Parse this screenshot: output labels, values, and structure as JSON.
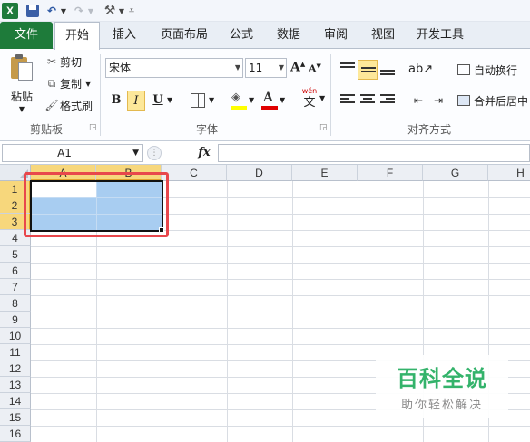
{
  "quick_access": {
    "app_icon": "X",
    "icons": [
      "excel-logo-icon",
      "save-icon",
      "undo-icon",
      "redo-icon",
      "customize-tools-icon"
    ]
  },
  "tabs": [
    {
      "id": "file",
      "label": "文件"
    },
    {
      "id": "home",
      "label": "开始"
    },
    {
      "id": "insert",
      "label": "插入"
    },
    {
      "id": "layout",
      "label": "页面布局"
    },
    {
      "id": "formulas",
      "label": "公式"
    },
    {
      "id": "data",
      "label": "数据"
    },
    {
      "id": "review",
      "label": "审阅"
    },
    {
      "id": "view",
      "label": "视图"
    },
    {
      "id": "developer",
      "label": "开发工具"
    }
  ],
  "active_tab": "home",
  "ribbon": {
    "clipboard": {
      "paste": "粘贴",
      "cut": "剪切",
      "copy": "复制",
      "format_painter": "格式刷",
      "group_label": "剪贴板"
    },
    "font": {
      "name": "宋体",
      "size": "11",
      "grow": "A",
      "shrink": "A",
      "bold": "B",
      "italic": "I",
      "underline": "U",
      "font_color_glyph": "A",
      "phonetic_top": "wén",
      "phonetic_main": "文",
      "highlight_color": "#ffff00",
      "font_color": "#e00000",
      "group_label": "字体"
    },
    "alignment": {
      "wrap_text": "自动换行",
      "merge_center": "合并后居中",
      "group_label": "对齐方式"
    }
  },
  "formula_bar": {
    "name_box": "A1",
    "fx": "fx",
    "formula": ""
  },
  "grid": {
    "columns": [
      "A",
      "B",
      "C",
      "D",
      "E",
      "F",
      "G",
      "H"
    ],
    "rows": [
      "1",
      "2",
      "3",
      "4",
      "5",
      "6",
      "7",
      "8",
      "9",
      "10",
      "11",
      "12",
      "13",
      "14",
      "15",
      "16"
    ],
    "selected_range": "A1:B3",
    "active_cell": "A1",
    "selection_color": "#a8cdf1",
    "highlight_box_color": "#e8474c"
  },
  "watermark": {
    "title": "百科全说",
    "subtitle": "助你轻松解决",
    "color": "#34b36b"
  }
}
